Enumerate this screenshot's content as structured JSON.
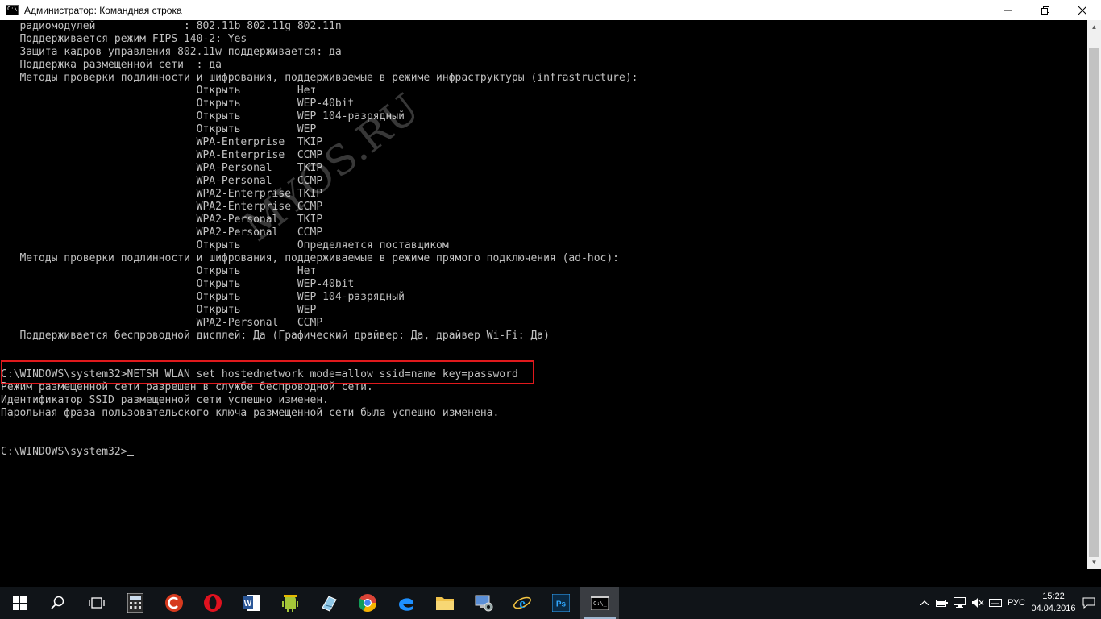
{
  "window": {
    "title": "Администратор: Командная строка",
    "app_icon_text": "C:\\"
  },
  "console": {
    "lines": [
      "   радиомодулей              : 802.11b 802.11g 802.11n",
      "   Поддерживается режим FIPS 140-2: Yes",
      "   Защита кадров управления 802.11w поддерживается: да",
      "   Поддержка размещенной сети  : да",
      "   Методы проверки подлинности и шифрования, поддерживаемые в режиме инфраструктуры (infrastructure):",
      "                               Открыть         Нет",
      "                               Открыть         WEP-40bit",
      "                               Открыть         WEP 104-разрядный",
      "                               Открыть         WEP",
      "                               WPA-Enterprise  TKIP",
      "                               WPA-Enterprise  CCMP",
      "                               WPA-Personal    TKIP",
      "                               WPA-Personal    CCMP",
      "                               WPA2-Enterprise TKIP",
      "                               WPA2-Enterprise CCMP",
      "                               WPA2-Personal   TKIP",
      "                               WPA2-Personal   CCMP",
      "                               Открыть         Определяется поставщиком",
      "   Методы проверки подлинности и шифрования, поддерживаемые в режиме прямого подключения (ad-hoc):",
      "                               Открыть         Нет",
      "                               Открыть         WEP-40bit",
      "                               Открыть         WEP 104-разрядный",
      "                               Открыть         WEP",
      "                               WPA2-Personal   CCMP",
      "   Поддерживается беспроводной дисплей: Да (Графический драйвер: Да, драйвер Wi-Fi: Да)",
      "",
      "",
      "C:\\WINDOWS\\system32>NETSH WLAN set hostednetwork mode=allow ssid=name key=password",
      "Режим размещенной сети разрешен в службе беспроводной сети.",
      "Идентификатор SSID размещенной сети успешно изменен.",
      "Парольная фраза пользовательского ключа размещенной сети была успешно изменена.",
      "",
      "",
      "C:\\WINDOWS\\system32>"
    ],
    "watermark": "MYOS.RU"
  },
  "taskbar": {
    "items": [
      "start-icon",
      "search-icon",
      "task-view-icon",
      "calculator-icon",
      "ccleaner-icon",
      "opera-icon",
      "word-icon",
      "android-icon",
      "notepad-icon",
      "chrome-icon",
      "edge-icon",
      "explorer-icon",
      "control-panel-icon",
      "ie-icon",
      "photoshop-icon",
      "cmd-icon"
    ],
    "language": "РУС",
    "time": "15:22",
    "date": "04.04.2016"
  },
  "colors": {
    "console_text": "#c0c0c0",
    "highlight_border": "#e0191c",
    "taskbar": "#101418"
  }
}
